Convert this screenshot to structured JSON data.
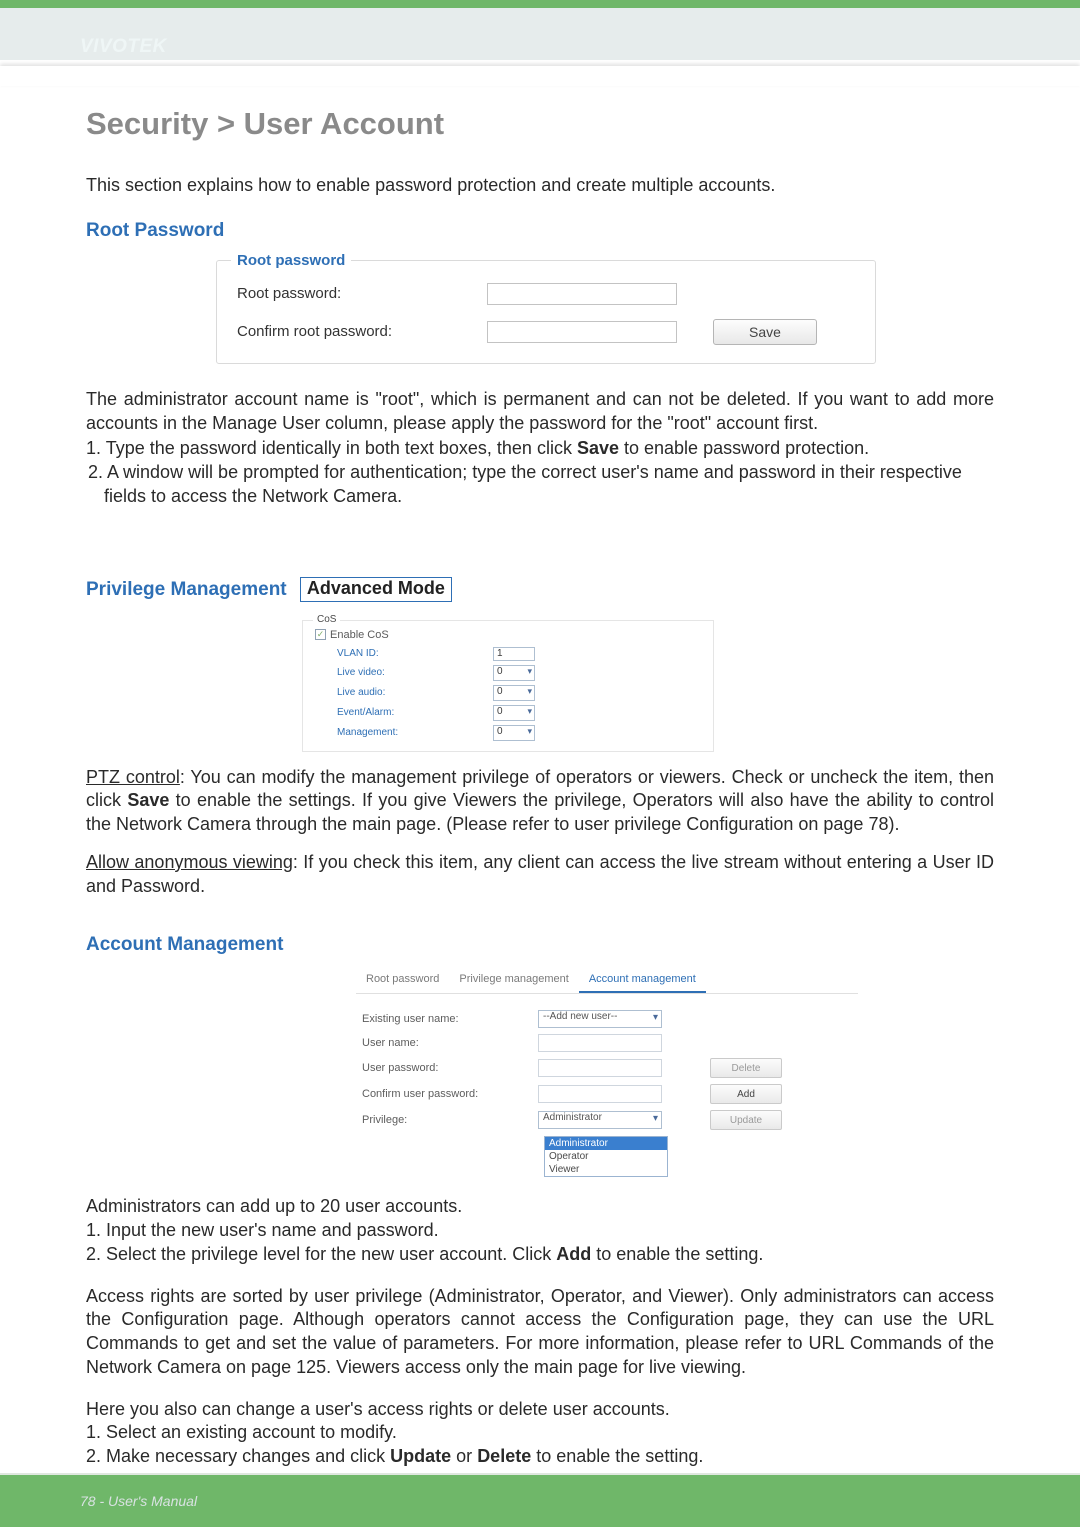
{
  "brand": "VIVOTEK",
  "h1": "Security > User Account",
  "intro": "This section explains how to enable password protection and create multiple accounts.",
  "section_root_password": "Root Password",
  "root_panel": {
    "legend": "Root password",
    "row1_label": "Root password:",
    "row2_label": "Confirm root password:",
    "save": "Save"
  },
  "root_desc": "The administrator account name is \"root\", which is permanent and can not be deleted. If you want to add more accounts in the Manage User column, please apply the password for the \"root\" account first.",
  "root_steps": {
    "s1a": "1. Type the password identically in both text boxes, then click ",
    "s1b": "Save",
    "s1c": " to enable password protection.",
    "s2": "2. A window will be prompted for authentication; type the correct user's name and password in their respective fields to access the Network Camera."
  },
  "section_priv": "Privilege Management",
  "adv_mode": "Advanced Mode",
  "cos": {
    "legend": "CoS",
    "enable": "Enable CoS",
    "rows": {
      "vlan": "VLAN ID:",
      "live_video": "Live video:",
      "live_audio": "Live audio:",
      "event_alarm": "Event/Alarm:",
      "management": "Management:"
    },
    "vlan_value": "1",
    "zero": "0"
  },
  "ptz_a": "PTZ control",
  "ptz_b": ": You can modify the management privilege of operators or viewers. Check or uncheck the item, then click ",
  "ptz_save": "Save",
  "ptz_c": " to enable the settings. If you give Viewers the privilege, Operators will also have the ability to control the Network Camera through the main page. (Please refer to user privilege Configuration on page 78).",
  "anon_a": "Allow anonymous viewing",
  "anon_b": ": If you check this item, any client can access the live stream without entering a User ID and Password.",
  "section_acct": "Account Management",
  "acct_shot": {
    "tabs": {
      "root": "Root password",
      "priv": "Privilege management",
      "acct": "Account management"
    },
    "rows": {
      "existing": "Existing user name:",
      "user": "User name:",
      "pass": "User password:",
      "confirm": "Confirm user password:",
      "privilege": "Privilege:"
    },
    "add_new_user": "--Add new user--",
    "delete": "Delete",
    "add": "Add",
    "update": "Update",
    "priv_selected": "Administrator",
    "priv_options": {
      "admin": "Administrator",
      "operator": "Operator",
      "viewer": "Viewer"
    }
  },
  "acct_desc1": "Administrators can add up to 20 user accounts.",
  "acct_step1": "1. Input the new user's name and password.",
  "acct_step2a": "2. Select the privilege level for the new user account. Click ",
  "acct_step2b": "Add",
  "acct_step2c": " to enable the setting.",
  "acct_rights": "Access rights are sorted by user privilege (Administrator, Operator, and Viewer). Only administrators can access the Configuration page. Although operators cannot access the Configuration page, they can use the URL Commands to get and set the value of parameters. For more information, please refer to URL Commands of the Network Camera on page 125. Viewers access only the main page for live viewing.",
  "acct_change_intro": "Here you also can change a user's access rights or delete user accounts.",
  "acct_change1": "1. Select an existing account to modify.",
  "acct_change2a": "2. Make necessary changes and click ",
  "acct_change2b": "Update",
  "acct_change2c": " or ",
  "acct_change2d": "Delete",
  "acct_change2e": " to enable the setting.",
  "footer": "78 - User's Manual"
}
